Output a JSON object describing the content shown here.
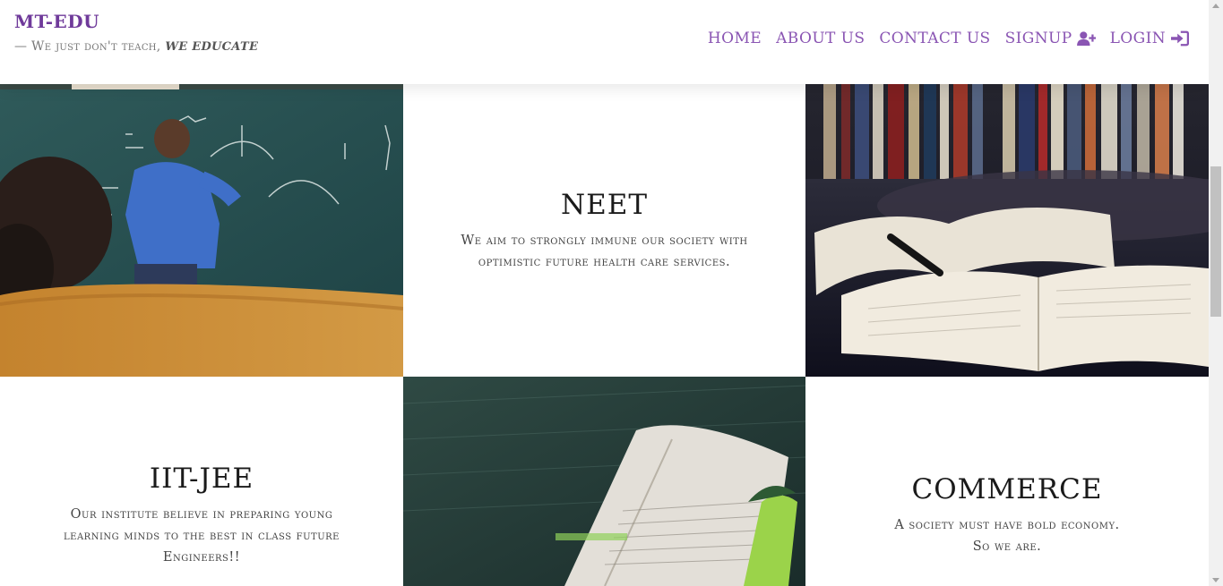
{
  "header": {
    "brand": "MT-EDU",
    "tagline_prefix": "— We just don't teach,",
    "tagline_emphasis": "we educate"
  },
  "nav": {
    "home": "HOME",
    "about": "ABOUT US",
    "contact": "CONTACT US",
    "signup": "SIGNUP",
    "login": "LOGIN"
  },
  "colors": {
    "accent": "#8a55b3",
    "brand": "#6f3a9a"
  },
  "tiles": {
    "neet": {
      "title": "NEET",
      "description": "We aim to strongly immune our society with optimistic future health care services."
    },
    "iitjee": {
      "title": "IIT-JEE",
      "description": "Our institute believe in preparing young learning minds to the best in class future Engineers!!"
    },
    "commerce": {
      "title": "COMMERCE",
      "description_line1": "A society must have bold economy.",
      "description_line2": "So we are."
    }
  },
  "icons": {
    "signup": "user-plus-icon",
    "login": "sign-in-icon"
  }
}
